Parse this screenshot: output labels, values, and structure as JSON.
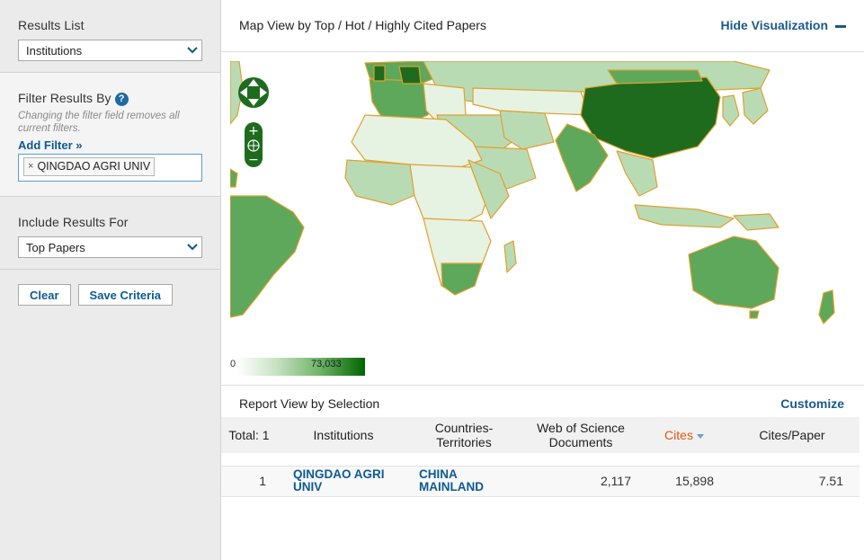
{
  "sidebar": {
    "results_list": {
      "title": "Results List",
      "selected": "Institutions"
    },
    "filter": {
      "title": "Filter Results By",
      "help": "?",
      "note": "Changing the filter field removes all current filters.",
      "add_filter": "Add Filter »",
      "chip_remove": "×",
      "chip": "QINGDAO AGRI UNIV"
    },
    "include": {
      "title": "Include Results For",
      "selected": "Top Papers"
    },
    "buttons": {
      "clear": "Clear",
      "save": "Save Criteria"
    }
  },
  "map": {
    "title": "Map View by Top / Hot / Highly Cited Papers",
    "hide": "Hide Visualization",
    "legend_min": "0",
    "legend_max": "73,033",
    "colors": {
      "dark": "#1e6b1e",
      "mid": "#5da85a",
      "light": "#b9dbb4",
      "pale": "#e6f2e2",
      "border": "#e1a02d"
    }
  },
  "report": {
    "title": "Report View by Selection",
    "customize": "Customize",
    "columns": {
      "total": "Total: 1",
      "institutions": "Institutions",
      "countries": "Countries-Territories",
      "wos": "Web of Science Documents",
      "cites": "Cites",
      "cites_paper": "Cites/Paper"
    },
    "rows": [
      {
        "rank": "1",
        "institution": "QINGDAO AGRI UNIV",
        "country": "CHINA MAINLAND",
        "wos": "2,117",
        "cites": "15,898",
        "cites_paper": "7.51"
      }
    ]
  }
}
